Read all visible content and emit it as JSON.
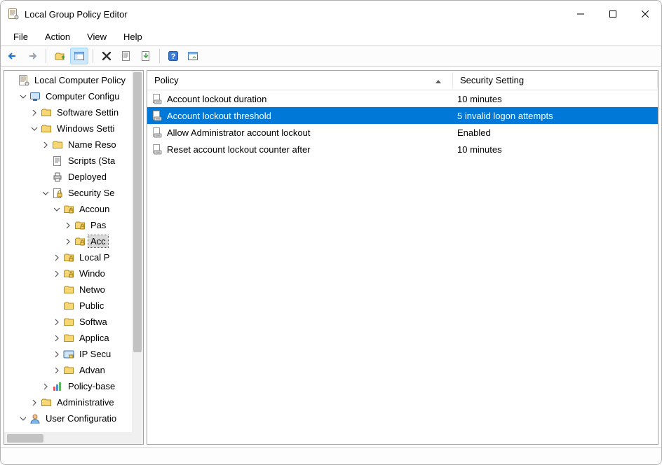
{
  "window": {
    "title": "Local Group Policy Editor"
  },
  "menu": {
    "file": "File",
    "action": "Action",
    "view": "View",
    "help": "Help"
  },
  "columns": {
    "policy": "Policy",
    "setting": "Security Setting"
  },
  "policies": [
    {
      "name": "Account lockout duration",
      "value": "10 minutes",
      "selected": false
    },
    {
      "name": "Account lockout threshold",
      "value": "5 invalid logon attempts",
      "selected": true
    },
    {
      "name": "Allow Administrator account lockout",
      "value": "Enabled",
      "selected": false
    },
    {
      "name": "Reset account lockout counter after",
      "value": "10 minutes",
      "selected": false
    }
  ],
  "tree": {
    "root": "Local Computer Policy",
    "computer_config": "Computer Configu",
    "software_settings": "Software Settin",
    "windows_settings": "Windows Setti",
    "name_res": "Name Reso",
    "scripts": "Scripts (Sta",
    "deployed": "Deployed",
    "security": "Security Se",
    "account": "Accoun",
    "password": "Pas",
    "account_lockout": "Acc",
    "local_p": "Local P",
    "windows_fw": "Windo",
    "network": "Netwo",
    "public": "Public",
    "software_r": "Softwa",
    "app": "Applica",
    "ip_sec": "IP Secu",
    "advanced": "Advan",
    "policy_based": "Policy-base",
    "admin_templates": "Administrative",
    "user_config": "User Configuratio"
  }
}
